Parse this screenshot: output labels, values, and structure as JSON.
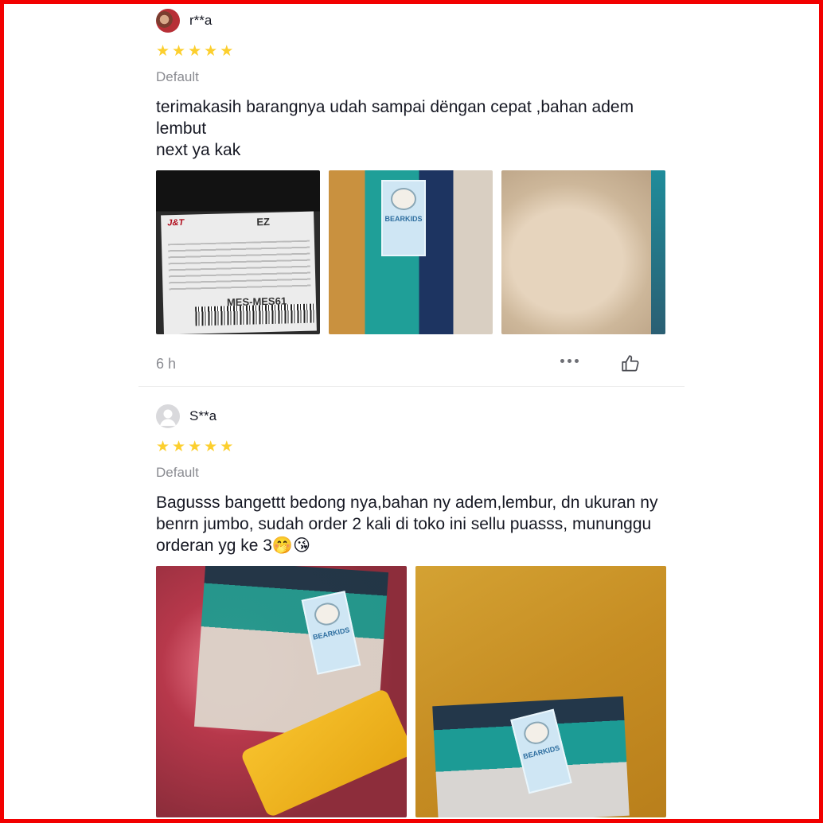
{
  "reviews": [
    {
      "username": "r**a",
      "rating": 5,
      "variant": "Default",
      "text": "terimakasih barangnya udah sampai dëngan cepat ,bahan adem lembut\nnext ya kak",
      "photos": [
        {
          "subject": "shipping-label",
          "brand": "J&T",
          "code": "EZ",
          "label_id": "MES-MES61"
        },
        {
          "subject": "stacked-swaddles",
          "tag_text": "BEARKIDS"
        },
        {
          "subject": "beige-fabric"
        }
      ],
      "time": "6 h"
    },
    {
      "username": "S**a",
      "rating": 5,
      "variant": "Default",
      "text": "Bagusss bangettt bedong nya,bahan ny adem,lembur, dn ukuran ny benrn jumbo, sudah order 2 kali di toko ini sellu puasss, mununggu orderan yg ke 3🤭😘",
      "photos": [
        {
          "subject": "bundled-swaddles",
          "tag_text": "BEARKIDS"
        },
        {
          "subject": "mustard-fabric",
          "tag_text": "BEARKIDS"
        }
      ]
    }
  ],
  "colors": {
    "star": "#fccf2e",
    "muted_text": "#8a8b91",
    "frame_border": "#f20000"
  },
  "icons": [
    "star-icon",
    "more-options-icon",
    "thumbs-up-icon",
    "user-avatar-icon"
  ]
}
